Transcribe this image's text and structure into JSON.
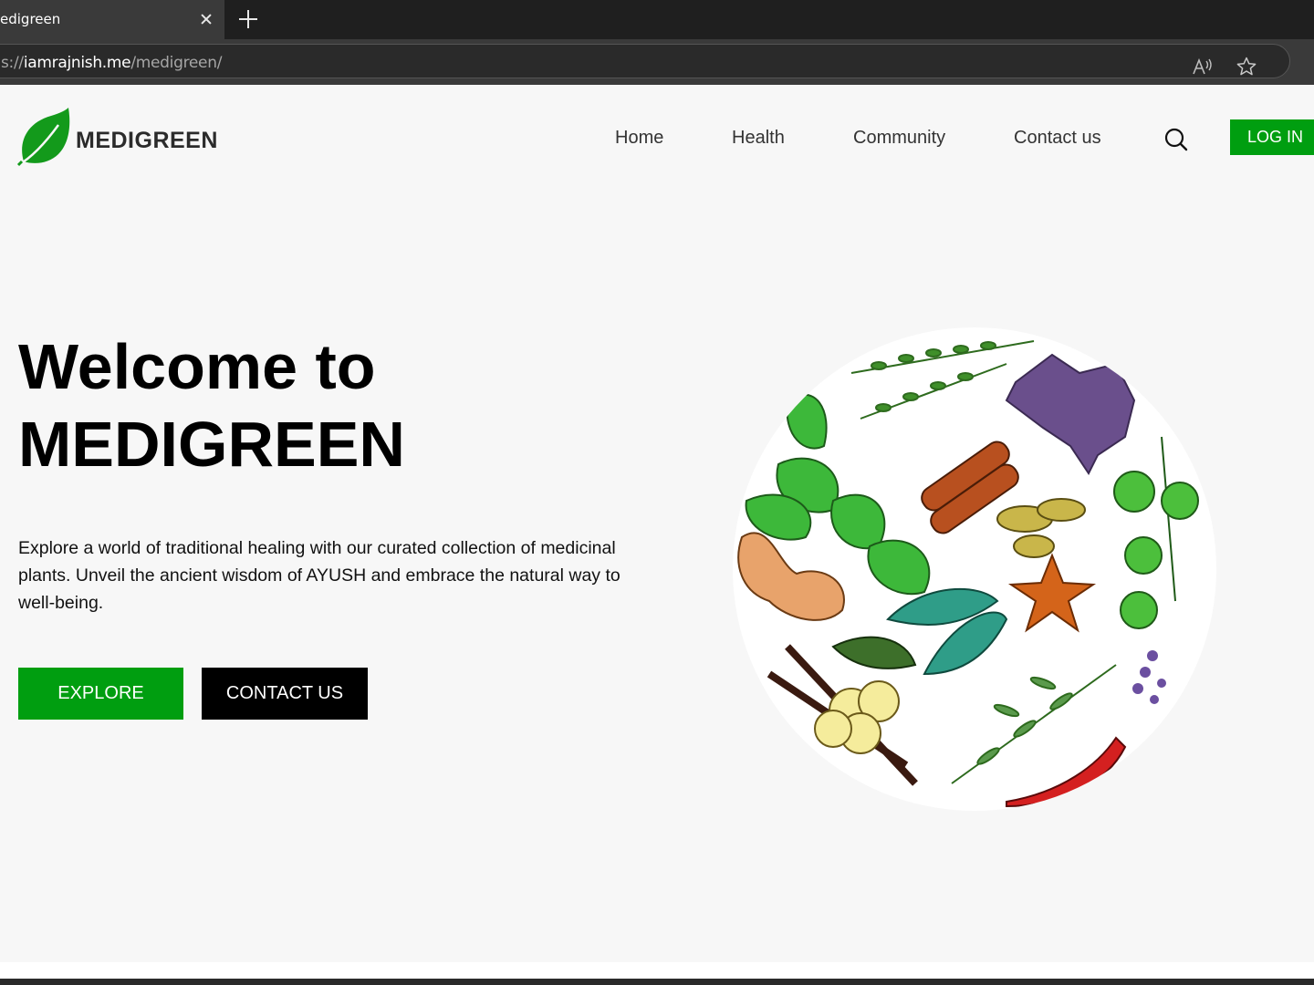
{
  "browser": {
    "tab_title": "edigreen",
    "url_prefix": "s://",
    "url_host": "iamrajnish.me",
    "url_path": "/medigreen/",
    "icons": [
      "close-icon",
      "plus-icon",
      "read-aloud-icon",
      "star-icon"
    ]
  },
  "header": {
    "logo_text": "MEDIGREEN",
    "nav": [
      "Home",
      "Health",
      "Community",
      "Contact us"
    ],
    "login_label": "LOG IN"
  },
  "hero": {
    "title_line1": "Welcome to",
    "title_line2": "MEDIGREEN",
    "description": "Explore a world of traditional healing with our curated collection of medicinal plants. Unveil the ancient wisdom of AYUSH and embrace the natural way to well-being.",
    "explore_label": "EXPLORE",
    "contact_label": "CONTACT US"
  },
  "colors": {
    "brand_green": "#009e10",
    "page_bg": "#f7f7f7",
    "dark": "#000000"
  }
}
